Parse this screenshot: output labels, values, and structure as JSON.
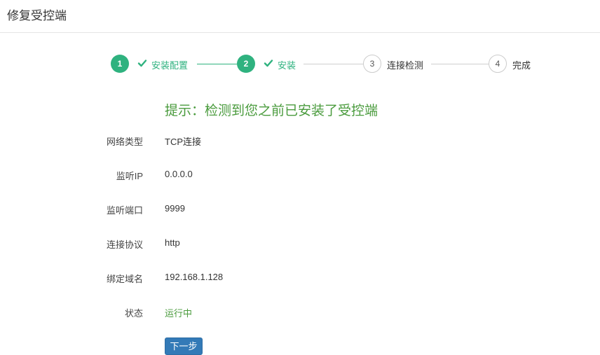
{
  "page": {
    "title": "修复受控端"
  },
  "steps": [
    {
      "number": "1",
      "label": "安装配置",
      "status": "done"
    },
    {
      "number": "2",
      "label": "安装",
      "status": "done"
    },
    {
      "number": "3",
      "label": "连接检测",
      "status": "todo"
    },
    {
      "number": "4",
      "label": "完成",
      "status": "todo"
    }
  ],
  "notice": "提示：检测到您之前已安装了受控端",
  "fields": [
    {
      "label": "网络类型",
      "value": "TCP连接"
    },
    {
      "label": "监听IP",
      "value": "0.0.0.0"
    },
    {
      "label": "监听端口",
      "value": "9999"
    },
    {
      "label": "连接协议",
      "value": "http"
    },
    {
      "label": "绑定域名",
      "value": "192.168.1.128"
    },
    {
      "label": "状态",
      "value": "运行中"
    }
  ],
  "buttons": {
    "next": "下一步"
  },
  "colors": {
    "success": "#2fb27f",
    "notice": "#4a9b3d",
    "primary": "#337ab7"
  }
}
